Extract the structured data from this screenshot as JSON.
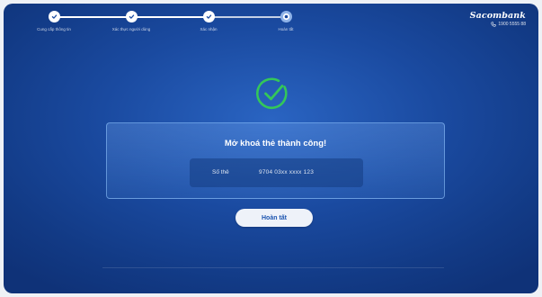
{
  "stepper": {
    "steps": [
      {
        "label": "Cung cấp thông tin",
        "state": "done"
      },
      {
        "label": "Xác thực người dùng",
        "state": "done"
      },
      {
        "label": "Xác nhận",
        "state": "done"
      },
      {
        "label": "Hoàn tất",
        "state": "current"
      }
    ]
  },
  "brand": {
    "name": "Sacombank",
    "phone": "1900 5555 88"
  },
  "result": {
    "title": "Mở khoá thẻ thành công!",
    "card_label": "Số thẻ",
    "card_number": "9704 03xx xxxx 123"
  },
  "actions": {
    "done_label": "Hoàn tất"
  },
  "colors": {
    "background": "#1a4aa0",
    "success": "#34c759",
    "button_text": "#1c55b0"
  }
}
